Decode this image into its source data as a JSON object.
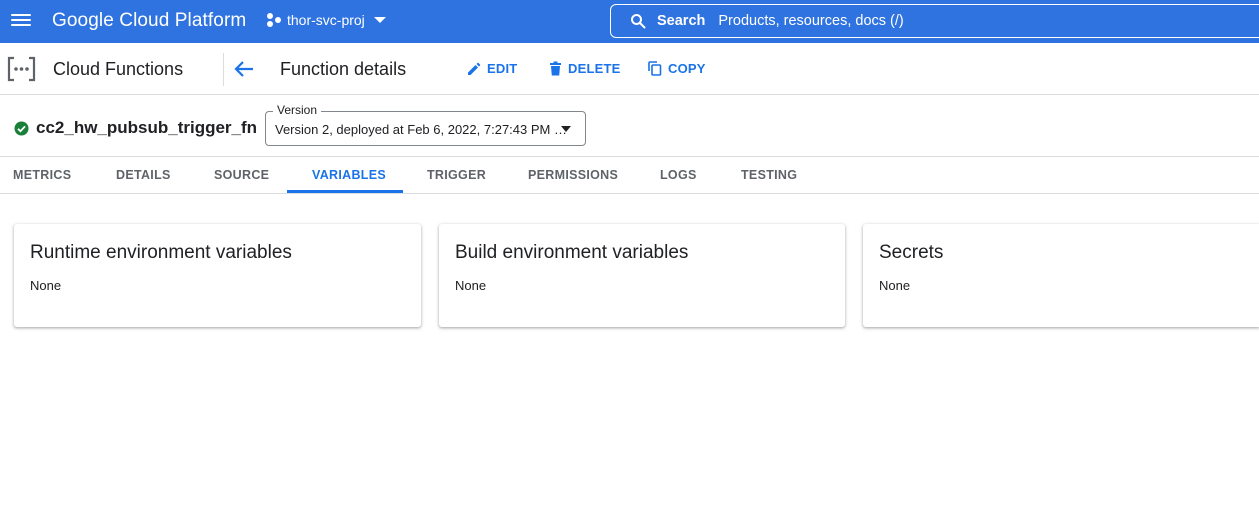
{
  "topbar": {
    "brand": "Google Cloud Platform",
    "project": "thor-svc-proj",
    "search_label": "Search",
    "search_hint": "Products, resources, docs (/)"
  },
  "subbar": {
    "product": "Cloud Functions",
    "page_title": "Function details",
    "actions": {
      "edit": "EDIT",
      "delete": "DELETE",
      "copy": "COPY"
    }
  },
  "function": {
    "name": "cc2_hw_pubsub_trigger_fn",
    "status": "ok",
    "version_label": "Version",
    "version_value": "Version 2, deployed at Feb 6, 2022, 7:27:43 PM …"
  },
  "tabs": [
    "METRICS",
    "DETAILS",
    "SOURCE",
    "VARIABLES",
    "TRIGGER",
    "PERMISSIONS",
    "LOGS",
    "TESTING"
  ],
  "active_tab": "VARIABLES",
  "cards": [
    {
      "title": "Runtime environment variables",
      "body": "None"
    },
    {
      "title": "Build environment variables",
      "body": "None"
    },
    {
      "title": "Secrets",
      "body": "None"
    }
  ],
  "colors": {
    "topbar": "#2f73e0",
    "accent": "#1a73e8",
    "status_ok": "#188038"
  }
}
